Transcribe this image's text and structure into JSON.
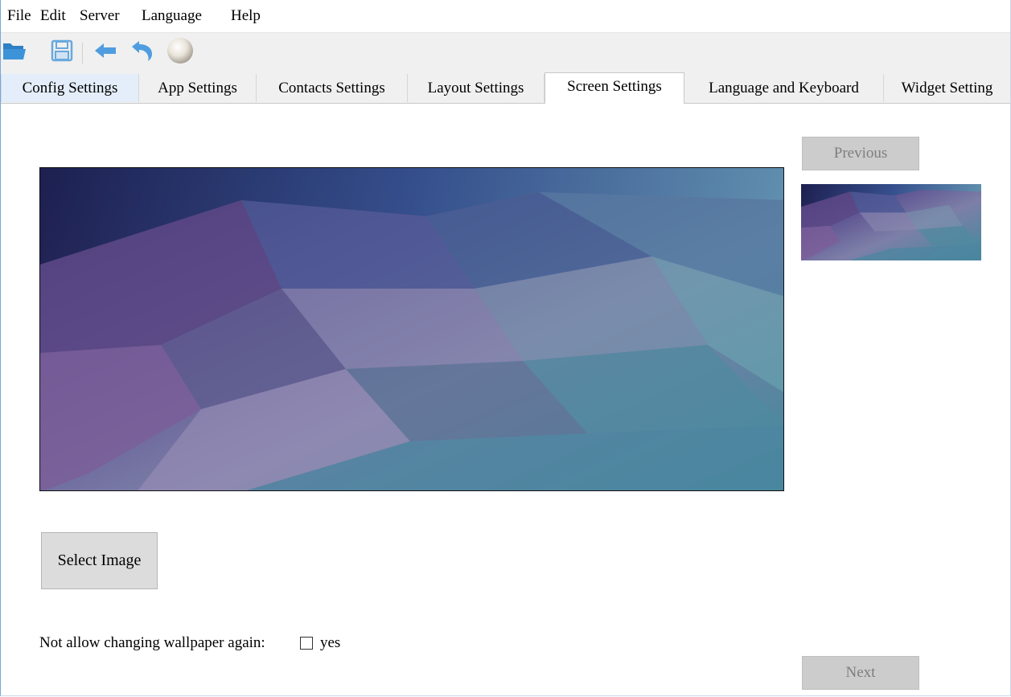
{
  "menubar": {
    "items": [
      "File",
      "Edit",
      "Server",
      "Language",
      "Help"
    ]
  },
  "toolbar": {
    "icons": [
      "folder-open-icon",
      "save-icon",
      "back-arrow-icon",
      "undo-icon",
      "sphere-icon"
    ],
    "colors": {
      "folder": "#3d8fd1",
      "save": "#6aa9dc",
      "arrow": "#4f9de0",
      "sphere": "#e9e4da"
    }
  },
  "tabs": {
    "items": [
      "Config Settings",
      "App Settings",
      "Contacts Settings",
      "Layout Settings",
      "Screen Settings",
      "Language and Keyboard",
      "Widget Setting"
    ],
    "active": "Screen Settings"
  },
  "screen": {
    "previous_label": "Previous",
    "next_label": "Next",
    "select_image_label": "Select Image",
    "lock_label": "Not allow changing wallpaper again:",
    "lock_option_label": "yes",
    "lock_checked": false
  },
  "colors": {
    "wallpaper_dark": "#2b2f66",
    "wallpaper_purple": "#7a5a95",
    "wallpaper_teal": "#4f8fa0",
    "window_border": "#7aa6d6",
    "disabled_button": "#cccccc"
  }
}
